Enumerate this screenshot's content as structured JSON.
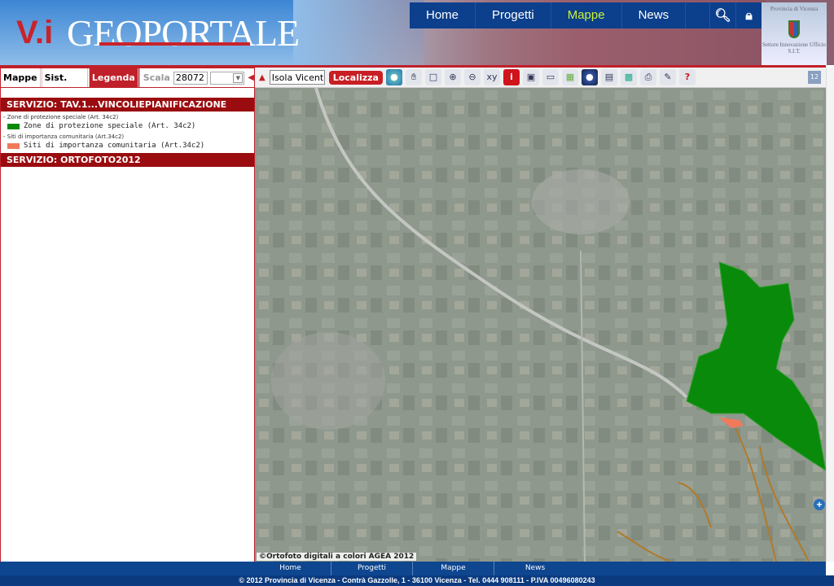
{
  "header": {
    "logo_mark": "V.i",
    "title": "GEOPORTALE",
    "nav": [
      "Home",
      "Progetti",
      "Mappe",
      "News"
    ],
    "active_nav": "Mappe",
    "province_logo_text": [
      "Provincia di Vicenza",
      "Settore Innovazione Ufficio S.I.T."
    ]
  },
  "left_tabs": {
    "tabs": [
      "Mappe",
      "Sist. coord.",
      "Legenda"
    ],
    "active": "Legenda",
    "scala_label": "Scala",
    "scala_value": "28072",
    "scala_select": ""
  },
  "toolbar": {
    "place_value": "Isola Vicentina",
    "localizza_label": "Localizza",
    "icons": [
      "globe-icon",
      "pan-hand-icon",
      "zoom-box-icon",
      "zoom-in-icon",
      "zoom-out-icon",
      "coordinates-xy-icon",
      "info-icon",
      "save-icon",
      "window-icon",
      "map-export-icon",
      "google-earth-icon",
      "add-layer-icon",
      "layers-sync-icon",
      "print-icon",
      "query-icon",
      "help-icon"
    ],
    "active_icon": "info-icon"
  },
  "legend": {
    "services": [
      {
        "title": "SERVIZIO: TAV.1...VINCOLIEPIANIFICAZIONE",
        "groups": [
          {
            "name": "- Zone di protezione speciale (Art. 34c2)",
            "item": "Zone di protezione speciale (Art. 34c2)",
            "color": "#0a8a0a"
          },
          {
            "name": "- Siti di importanza comunitaria (Art.34c2)",
            "item": "Siti di importanza comunitaria (Art.34c2)",
            "color": "#f07a5a"
          }
        ]
      },
      {
        "title": "SERVIZIO: ORTOFOTO2012",
        "groups": []
      }
    ]
  },
  "map": {
    "attribution": "©Ortofoto digitali a colori AGEA 2012",
    "zps_color": "#0a8a0a",
    "sic_color": "#f07a5a",
    "river_color": "#b07a2a"
  },
  "footer": {
    "nav": [
      "Home",
      "Progetti",
      "Mappe",
      "News"
    ],
    "text": "© 2012 Provincia di Vicenza - Contrà Gazzolle, 1 - 36100 Vicenza - Tel. 0444 908111 - P.IVA 00496080243"
  }
}
